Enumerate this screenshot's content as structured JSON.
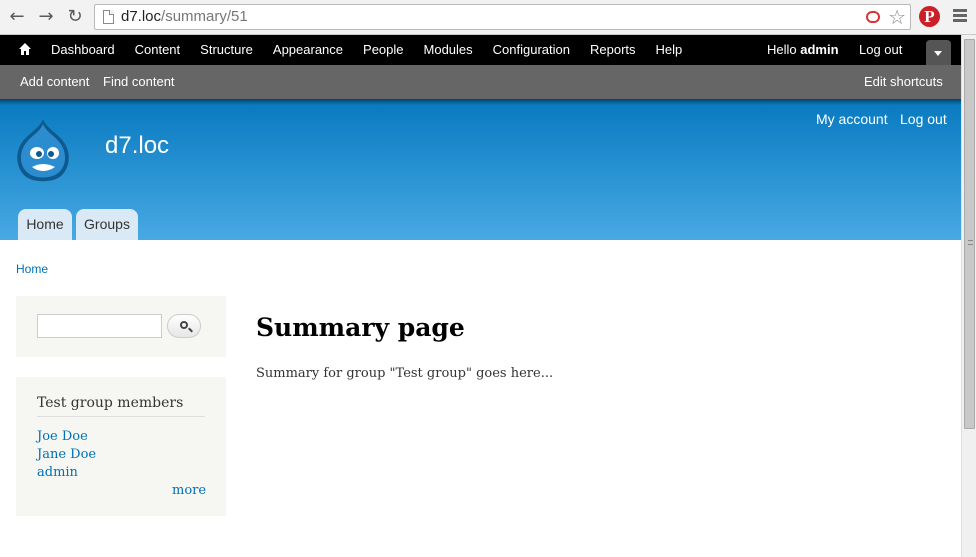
{
  "browser": {
    "url_host": "d7.loc",
    "url_path": "/summary/51",
    "back_icon": "arrow-left-icon",
    "forward_icon": "arrow-right-icon",
    "reload_icon": "reload-icon"
  },
  "toolbar": {
    "menu": [
      "Dashboard",
      "Content",
      "Structure",
      "Appearance",
      "People",
      "Modules",
      "Configuration",
      "Reports",
      "Help"
    ],
    "hello_prefix": "Hello ",
    "username": "admin",
    "logout": "Log out"
  },
  "shortcuts": {
    "add_content": "Add content",
    "find_content": "Find content",
    "edit_shortcuts": "Edit shortcuts"
  },
  "header": {
    "site_name": "d7.loc",
    "my_account": "My account",
    "logout": "Log out",
    "tabs": [
      "Home",
      "Groups"
    ]
  },
  "breadcrumb": "Home",
  "sidebar": {
    "search_value": "",
    "members_title": "Test group members",
    "members": [
      "Joe Doe",
      "Jane Doe",
      "admin"
    ],
    "more": "more"
  },
  "main": {
    "title": "Summary page",
    "body": "Summary for group \"Test group\" goes here..."
  },
  "colors": {
    "link": "#0071b3",
    "header_top": "#0779bf",
    "header_bottom": "#48a9e4"
  }
}
